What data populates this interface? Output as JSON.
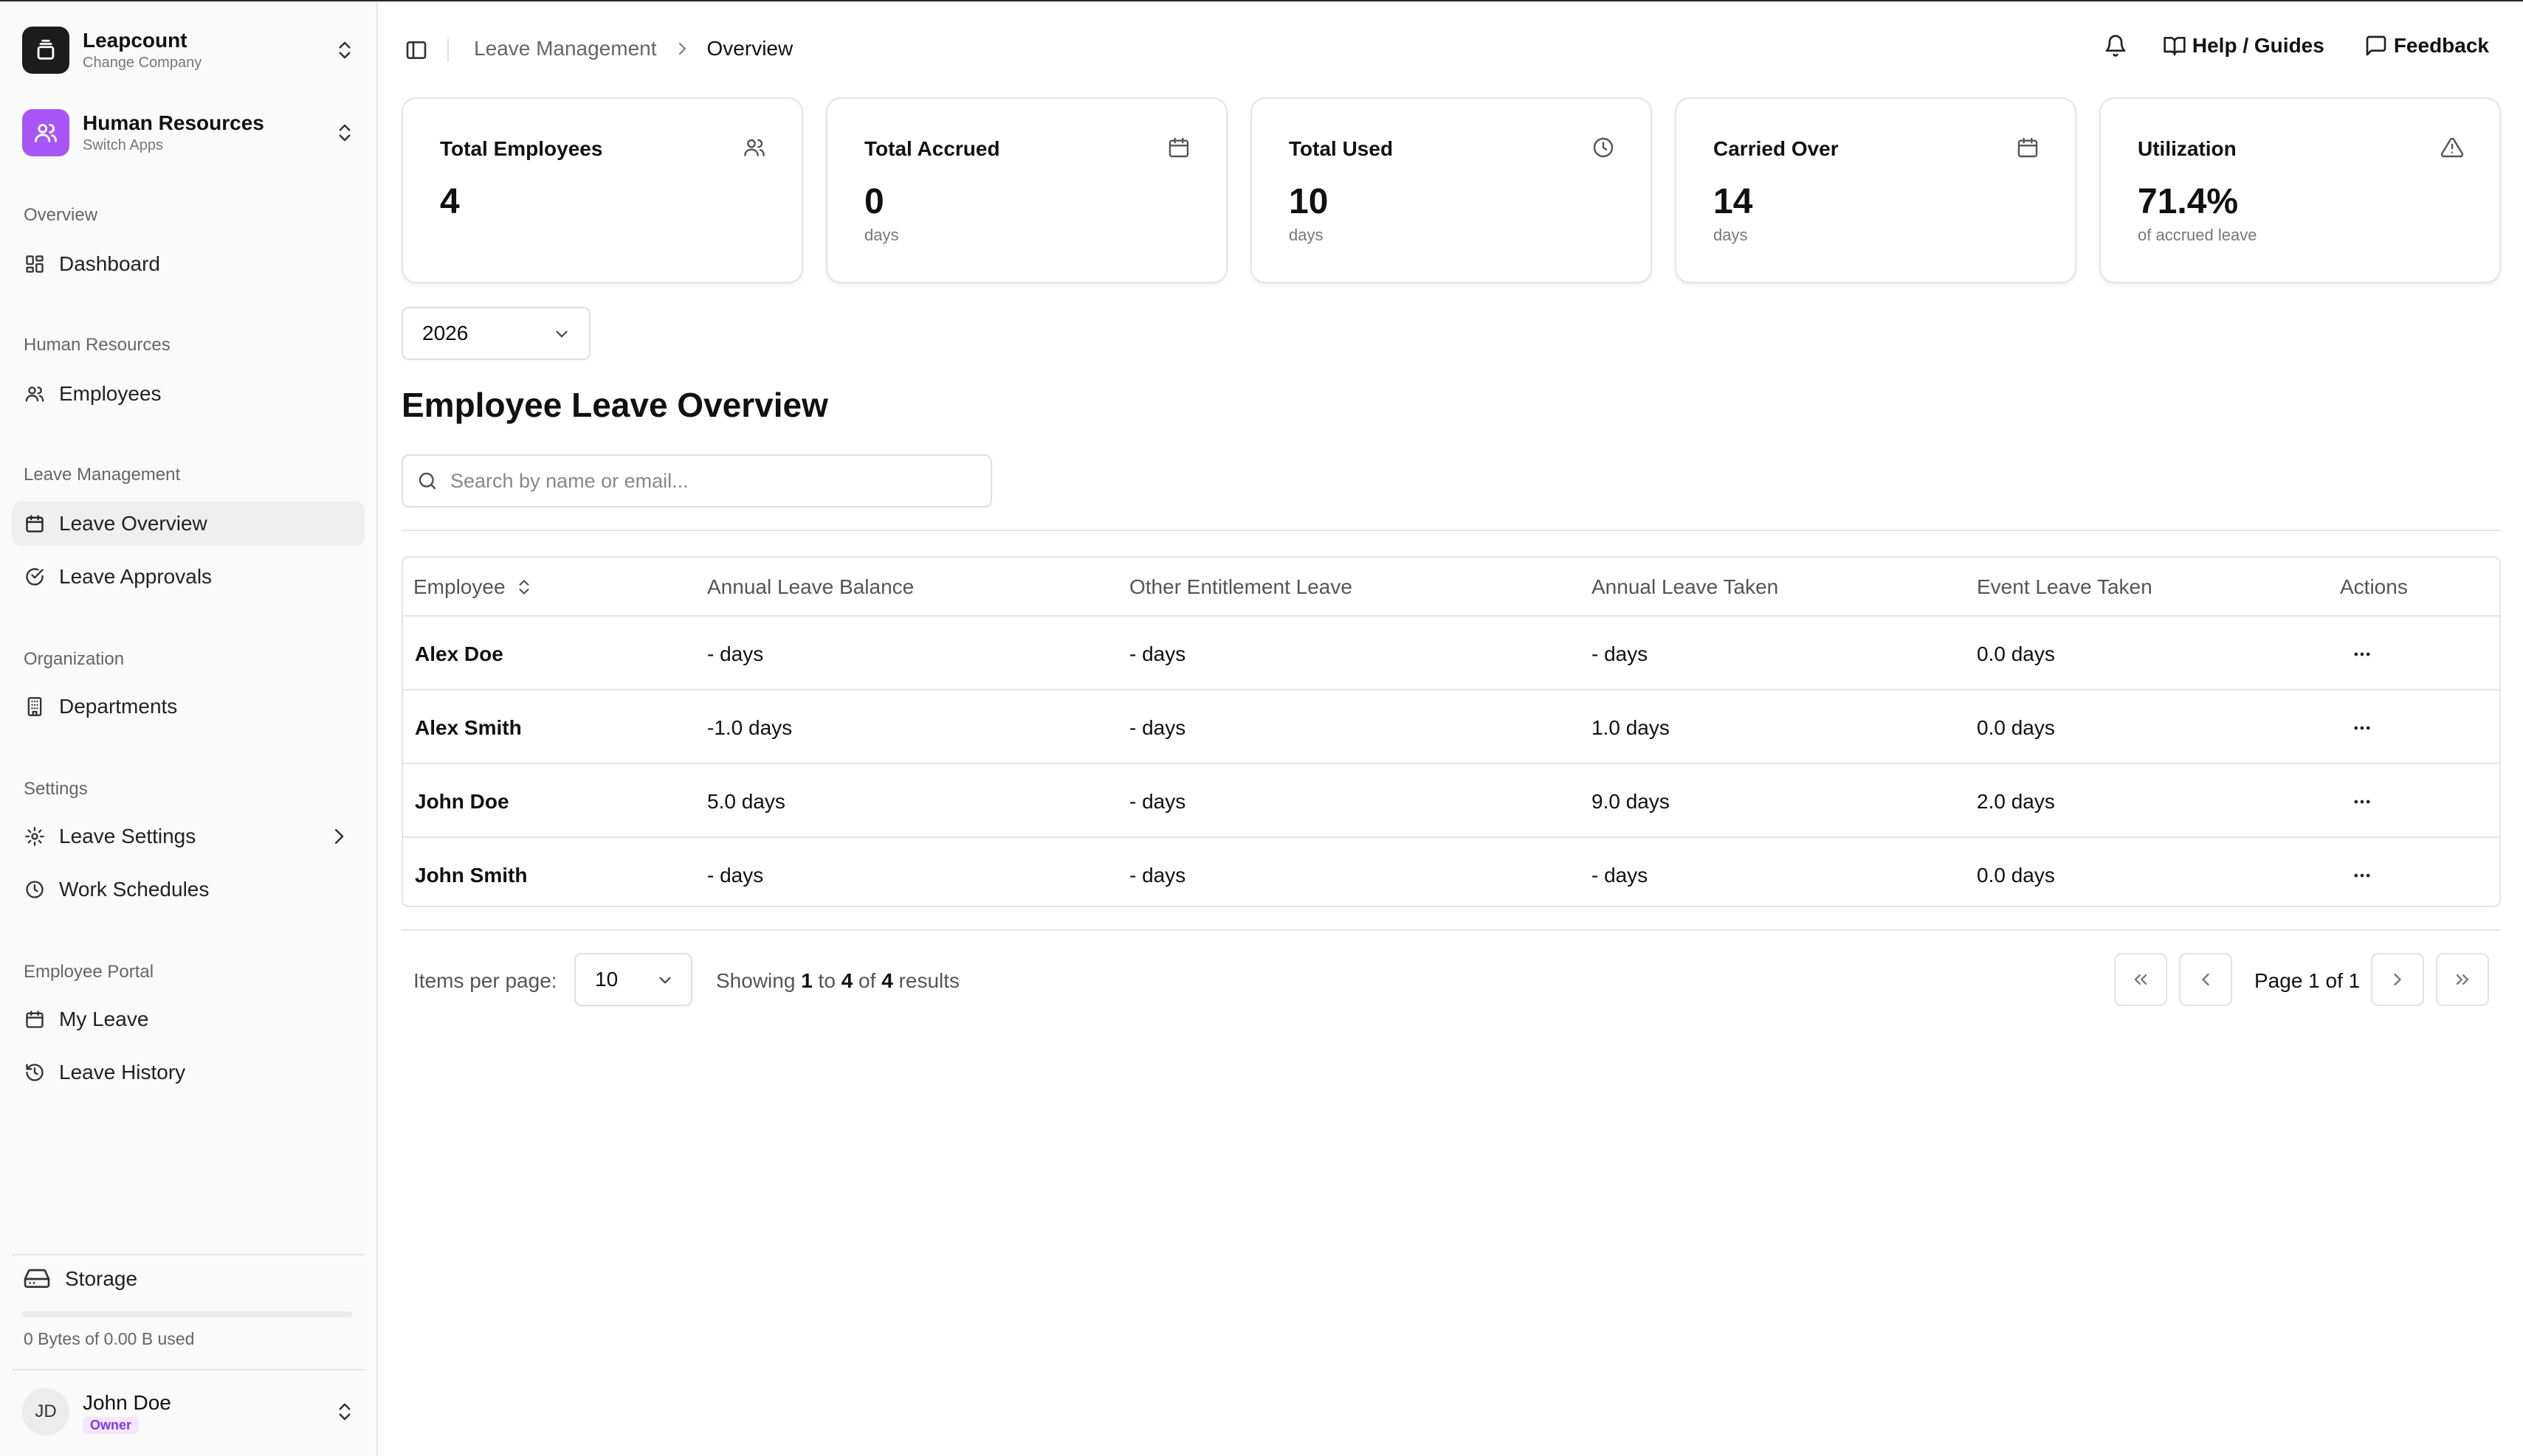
{
  "company": {
    "name": "Leapcount",
    "subtitle": "Change Company"
  },
  "app": {
    "name": "Human Resources",
    "subtitle": "Switch Apps",
    "accent": "#a855f7"
  },
  "sidebar": {
    "sections": [
      {
        "label": "Overview",
        "items": [
          {
            "label": "Dashboard",
            "icon": "dashboard-icon"
          }
        ]
      },
      {
        "label": "Human Resources",
        "items": [
          {
            "label": "Employees",
            "icon": "users-icon"
          }
        ]
      },
      {
        "label": "Leave Management",
        "items": [
          {
            "label": "Leave Overview",
            "icon": "calendar-icon",
            "active": true
          },
          {
            "label": "Leave Approvals",
            "icon": "check-circle-icon"
          }
        ]
      },
      {
        "label": "Organization",
        "items": [
          {
            "label": "Departments",
            "icon": "building-icon"
          }
        ]
      },
      {
        "label": "Settings",
        "items": [
          {
            "label": "Leave Settings",
            "icon": "gear-icon"
          },
          {
            "label": "Work Schedules",
            "icon": "clock-icon"
          }
        ]
      },
      {
        "label": "Employee Portal",
        "items": [
          {
            "label": "My Leave",
            "icon": "calendar-icon"
          },
          {
            "label": "Leave History",
            "icon": "history-icon"
          }
        ]
      }
    ],
    "storage": {
      "label": "Storage",
      "usage_text": "0 Bytes of 0.00 B used",
      "fraction": 0
    },
    "user": {
      "initials": "JD",
      "name": "John Doe",
      "role": "Owner"
    }
  },
  "header": {
    "breadcrumb": [
      "Leave Management",
      "Overview"
    ],
    "help_label": "Help / Guides",
    "feedback_label": "Feedback"
  },
  "stats": [
    {
      "title": "Total Employees",
      "value": "4",
      "sub": "",
      "icon": "users-icon"
    },
    {
      "title": "Total Accrued",
      "value": "0",
      "sub": "days",
      "icon": "calendar-icon"
    },
    {
      "title": "Total Used",
      "value": "10",
      "sub": "days",
      "icon": "clock-icon"
    },
    {
      "title": "Carried Over",
      "value": "14",
      "sub": "days",
      "icon": "calendar-icon"
    },
    {
      "title": "Utilization",
      "value": "71.4%",
      "sub": "of accrued leave",
      "icon": "warning-triangle-icon"
    }
  ],
  "year_select": {
    "value": "2026"
  },
  "main": {
    "title": "Employee Leave Overview",
    "search_placeholder": "Search by name or email..."
  },
  "table": {
    "columns": [
      "Employee",
      "Annual Leave Balance",
      "Other Entitlement Leave",
      "Annual Leave Taken",
      "Event Leave Taken",
      "Actions"
    ],
    "rows": [
      [
        "Alex Doe",
        "- days",
        "- days",
        "- days",
        "0.0 days"
      ],
      [
        "Alex Smith",
        "-1.0 days",
        "- days",
        "1.0 days",
        "0.0 days"
      ],
      [
        "John Doe",
        "5.0 days",
        "- days",
        "9.0 days",
        "2.0 days"
      ],
      [
        "John Smith",
        "- days",
        "- days",
        "- days",
        "0.0 days"
      ]
    ]
  },
  "pagination": {
    "items_per_page_label": "Items per page:",
    "items_per_page": "10",
    "showing_prefix": "Showing",
    "from": "1",
    "to_word": "to",
    "to": "4",
    "of_word": "of",
    "total": "4",
    "results_word": "results",
    "page_label": "Page 1 of 1"
  }
}
